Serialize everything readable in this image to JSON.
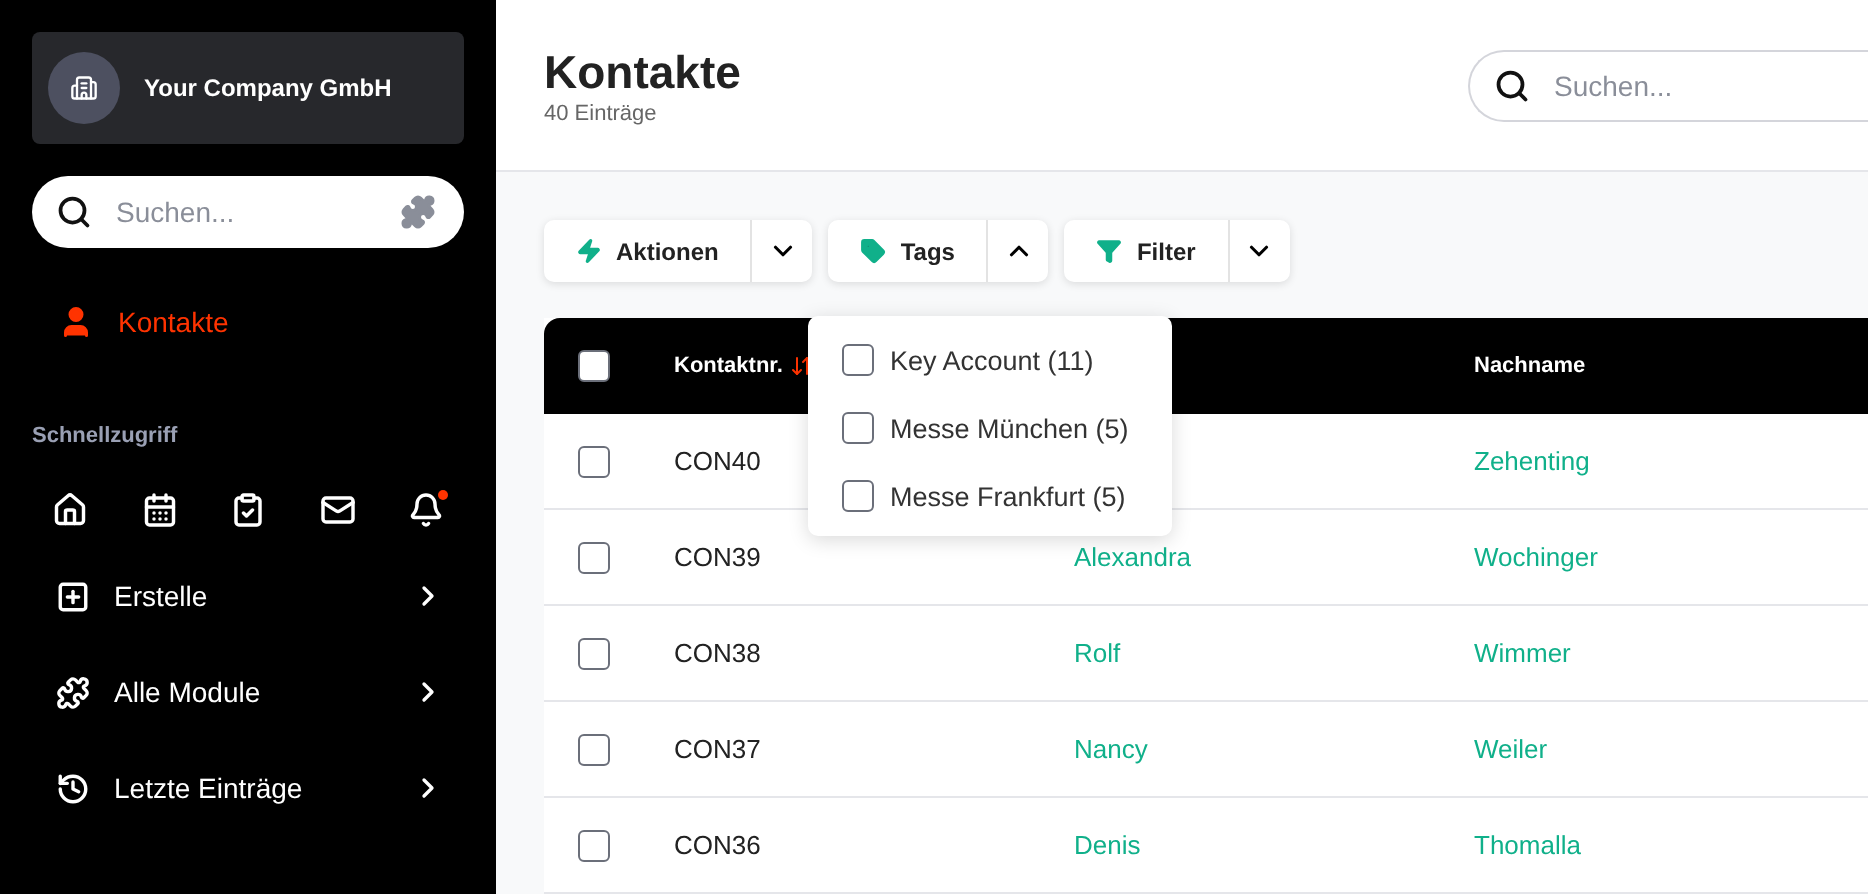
{
  "sidebar": {
    "company": "Your Company GmbH",
    "search": {
      "placeholder": "Suchen..."
    },
    "nav": [
      {
        "label": "Kontakte",
        "selected": true
      }
    ],
    "quick_access_title": "Schnellzugriff",
    "quick_icons": [
      {
        "kind": "home",
        "badge": false
      },
      {
        "kind": "calendar",
        "badge": false
      },
      {
        "kind": "clipboard",
        "badge": false
      },
      {
        "kind": "mail",
        "badge": false
      },
      {
        "kind": "bell",
        "badge": true
      }
    ],
    "menu": [
      {
        "kind": "plus",
        "label": "Erstelle"
      },
      {
        "kind": "puzzle",
        "label": "Alle Module"
      },
      {
        "kind": "history",
        "label": "Letzte Einträge"
      }
    ]
  },
  "header": {
    "title": "Kontakte",
    "subtitle": "40 Einträge",
    "search": {
      "placeholder": "Suchen..."
    }
  },
  "toolbar": [
    {
      "kind": "bolt",
      "label": "Aktionen",
      "expanded": false
    },
    {
      "kind": "tag",
      "label": "Tags",
      "expanded": true
    },
    {
      "kind": "filter",
      "label": "Filter",
      "expanded": false
    }
  ],
  "tags_menu": [
    {
      "label": "Key Account (11)",
      "checked": false
    },
    {
      "label": "Messe München (5)",
      "checked": false
    },
    {
      "label": "Messe Frankfurt (5)",
      "checked": false
    }
  ],
  "table": {
    "header_checked": false,
    "columns": [
      "Kontaktnr.",
      "",
      "Nachname"
    ],
    "rows": [
      {
        "checked": false,
        "number": "CON40",
        "first": "",
        "last": "Zehenting"
      },
      {
        "checked": false,
        "number": "CON39",
        "first": "Alexandra",
        "last": "Wochinger"
      },
      {
        "checked": false,
        "number": "CON38",
        "first": "Rolf",
        "last": "Wimmer"
      },
      {
        "checked": false,
        "number": "CON37",
        "first": "Nancy",
        "last": "Weiler"
      },
      {
        "checked": false,
        "number": "CON36",
        "first": "Denis",
        "last": "Thomalla"
      }
    ]
  }
}
